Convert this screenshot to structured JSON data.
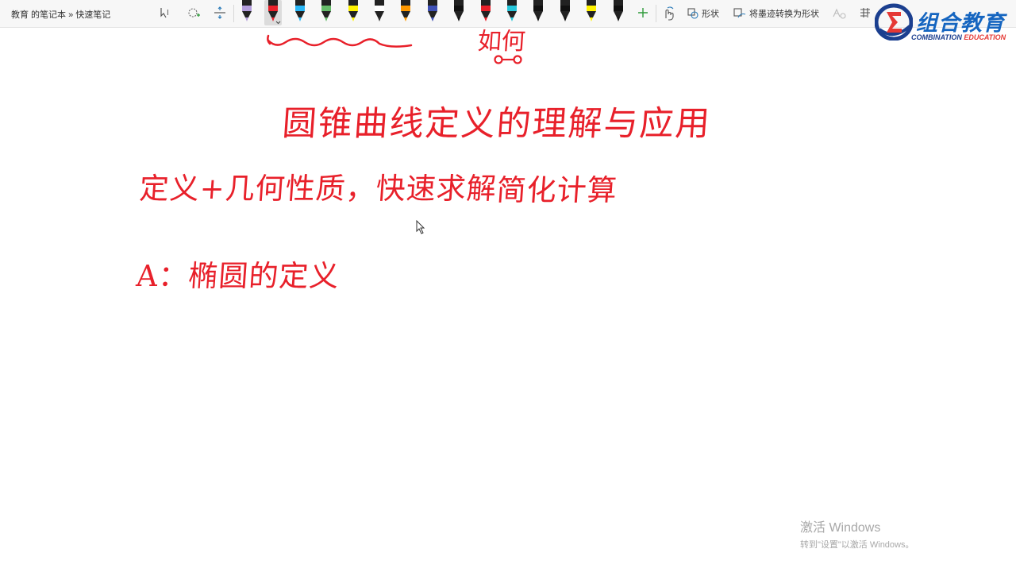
{
  "toolbar": {
    "breadcrumb": "教育 的笔记本 » 快速笔记",
    "shape_label": "形状",
    "ink_to_shape_label": "将墨迹转换为形状"
  },
  "pens": [
    {
      "color": "#222222",
      "tip": "#b39ddb"
    },
    {
      "color": "#222222",
      "tip": "#e8202a"
    },
    {
      "color": "#222222",
      "tip": "#29b6f6"
    },
    {
      "color": "#222222",
      "tip": "#66bb6a"
    },
    {
      "color": "#222222",
      "tip": "#fff200"
    },
    {
      "color": "#222222",
      "tip": "#ffffff"
    },
    {
      "color": "#222222",
      "tip": "#ff9800"
    },
    {
      "color": "#222222",
      "tip": "#3f51b5"
    },
    {
      "color": "#222222",
      "tip": "#111111"
    },
    {
      "color": "#222222",
      "tip": "#e8202a"
    },
    {
      "color": "#222222",
      "tip": "#26c6da"
    },
    {
      "color": "#222222",
      "tip": "#111111"
    },
    {
      "color": "#222222",
      "tip": "#111111"
    },
    {
      "color": "#222222",
      "tip": "#fff200"
    },
    {
      "color": "#222222",
      "tip": "#111111"
    }
  ],
  "logo": {
    "main": "组合教育",
    "sub_a": "COMBINATION ",
    "sub_b": "EDUCATION"
  },
  "notes": {
    "top_scribble": "~~",
    "top_partial": "如何",
    "title": "圆锥曲线定义的理解与应用",
    "line1_a": "定义+几何性质，快速求解",
    "line1_b": "简化计算",
    "line2": "A：椭圆的定义"
  },
  "watermark": {
    "title": "激活 Windows",
    "subtitle": "转到\"设置\"以激活 Windows。"
  },
  "colors": {
    "ink": "#e8202a",
    "toolbar_bg": "#f7f7f7",
    "logo_blue": "#1565c0",
    "logo_red": "#e53935"
  }
}
